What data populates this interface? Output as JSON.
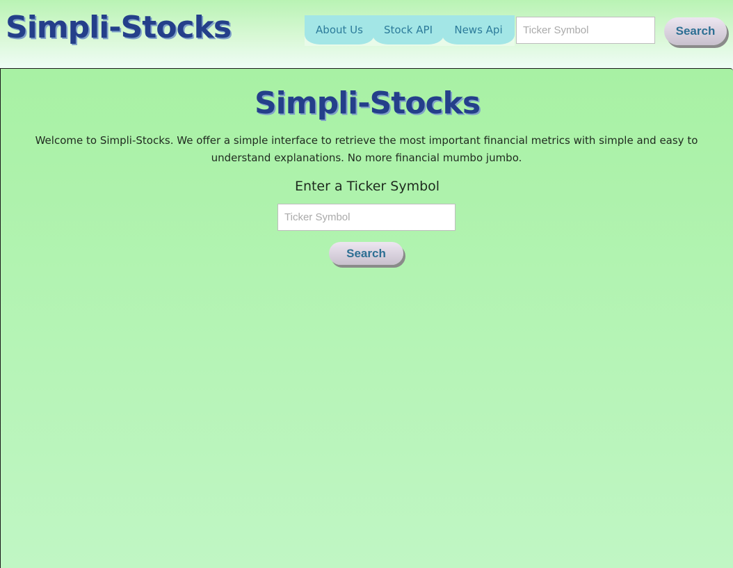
{
  "header": {
    "logo": "Simpli-Stocks",
    "nav": [
      "About Us",
      "Stock API",
      "News Api"
    ],
    "search_placeholder": "Ticker Symbol",
    "search_button": "Search"
  },
  "main": {
    "title": "Simpli-Stocks",
    "intro": "Welcome to Simpli-Stocks. We offer a simple interface to retrieve the most important financial metrics with simple and easy to understand explanations. No more financial mumbo jumbo.",
    "prompt": "Enter a Ticker Symbol",
    "input_placeholder": "Ticker Symbol",
    "search_button": "Search"
  },
  "colors": {
    "brand": "#243f8a",
    "nav_bg": "#a3e6e6",
    "nav_text": "#2c7b9a",
    "button_text": "#2d6f93",
    "main_bg": "#b4f3b4"
  }
}
